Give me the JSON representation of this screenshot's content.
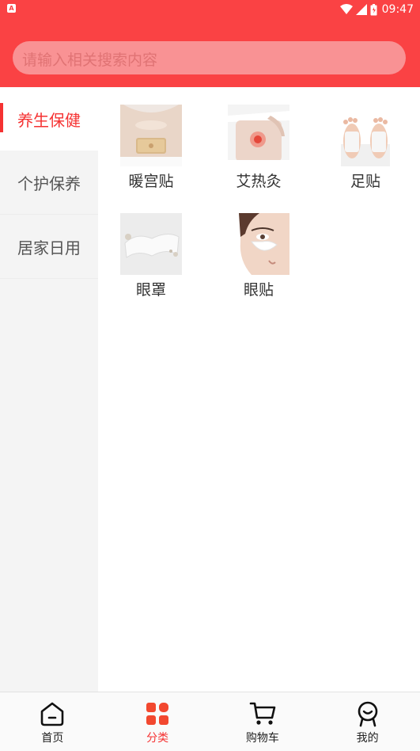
{
  "status_bar": {
    "time": "09:47"
  },
  "search": {
    "placeholder": "请输入相关搜索内容"
  },
  "sidebar": {
    "items": [
      {
        "label": "养生保健",
        "active": true
      },
      {
        "label": "个护保养",
        "active": false
      },
      {
        "label": "居家日用",
        "active": false
      }
    ]
  },
  "products": [
    {
      "label": "暖宫贴",
      "icon": "warming-patch-image"
    },
    {
      "label": "艾热灸",
      "icon": "moxibustion-image"
    },
    {
      "label": "足贴",
      "icon": "foot-patch-image"
    },
    {
      "label": "眼罩",
      "icon": "eye-mask-image"
    },
    {
      "label": "眼贴",
      "icon": "eye-patch-image"
    }
  ],
  "bottom_nav": [
    {
      "label": "首页",
      "icon": "home-icon",
      "active": false
    },
    {
      "label": "分类",
      "icon": "category-icon",
      "active": true
    },
    {
      "label": "购物车",
      "icon": "cart-icon",
      "active": false
    },
    {
      "label": "我的",
      "icon": "profile-icon",
      "active": false
    }
  ],
  "colors": {
    "brand": "#fa4244",
    "accent": "#f53232",
    "search_bg": "#f99294"
  }
}
